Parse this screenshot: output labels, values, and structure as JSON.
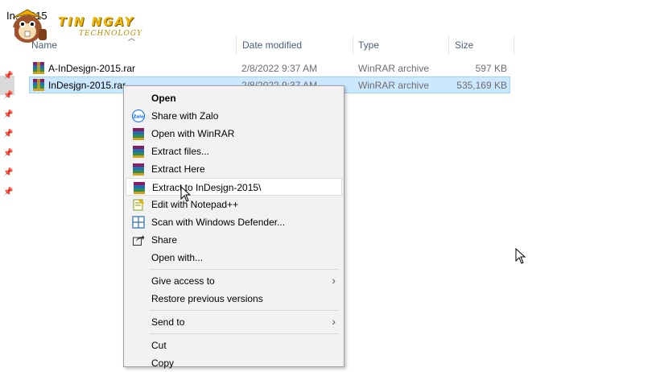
{
  "window": {
    "title": "In...2015"
  },
  "logo": {
    "brand": "TIN NGAY",
    "subtitle": "TECHNOLOGY"
  },
  "columns": {
    "name": "Name",
    "date_modified": "Date modified",
    "type": "Type",
    "size": "Size"
  },
  "files": [
    {
      "name": "A-InDesjgn-2015.rar",
      "date": "2/8/2022 9:37 AM",
      "type": "WinRAR archive",
      "size": "597 KB",
      "selected": false,
      "icon": "winrar-icon"
    },
    {
      "name": "InDesjgn-2015.rar",
      "date": "2/8/2022 9:37 AM",
      "type": "WinRAR archive",
      "size": "535,169 KB",
      "selected": true,
      "icon": "winrar-icon"
    }
  ],
  "context_menu": {
    "items": [
      {
        "label": "Open",
        "bold": true,
        "icon": ""
      },
      {
        "label": "Share with Zalo",
        "icon": "zalo-icon"
      },
      {
        "label": "Open with WinRAR",
        "icon": "winrar-icon"
      },
      {
        "label": "Extract files...",
        "icon": "winrar-icon"
      },
      {
        "label": "Extract Here",
        "icon": "winrar-icon"
      },
      {
        "label": "Extract to InDesjgn-2015\\",
        "icon": "winrar-icon",
        "hover": true
      },
      {
        "label": "Edit with Notepad++",
        "icon": "notepad-plus-plus-icon"
      },
      {
        "label": "Scan with Windows Defender...",
        "icon": "windows-defender-icon"
      },
      {
        "label": "Share",
        "icon": "share-icon"
      },
      {
        "label": "Open with...",
        "icon": ""
      },
      {
        "label": "Give access to",
        "icon": "",
        "submenu": true
      },
      {
        "label": "Restore previous versions",
        "icon": ""
      },
      {
        "label": "Send to",
        "icon": "",
        "submenu": true
      },
      {
        "label": "Cut",
        "icon": ""
      },
      {
        "label": "Copy",
        "icon": ""
      }
    ],
    "submenu_arrow": "›"
  },
  "colors": {
    "selection_bg": "#cce8ff",
    "selection_border": "#99d1ff",
    "menu_bg": "#f2f2f2",
    "header_text": "#4c607a"
  }
}
